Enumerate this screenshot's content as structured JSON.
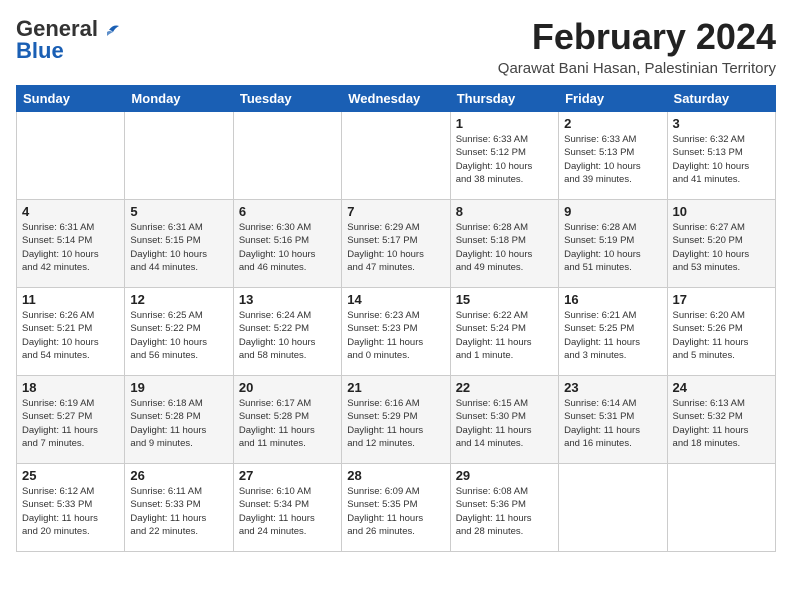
{
  "header": {
    "logo_line1": "General",
    "logo_line2": "Blue",
    "month_year": "February 2024",
    "location": "Qarawat Bani Hasan, Palestinian Territory"
  },
  "columns": [
    "Sunday",
    "Monday",
    "Tuesday",
    "Wednesday",
    "Thursday",
    "Friday",
    "Saturday"
  ],
  "weeks": [
    [
      {
        "day": "",
        "info": ""
      },
      {
        "day": "",
        "info": ""
      },
      {
        "day": "",
        "info": ""
      },
      {
        "day": "",
        "info": ""
      },
      {
        "day": "1",
        "info": "Sunrise: 6:33 AM\nSunset: 5:12 PM\nDaylight: 10 hours\nand 38 minutes."
      },
      {
        "day": "2",
        "info": "Sunrise: 6:33 AM\nSunset: 5:13 PM\nDaylight: 10 hours\nand 39 minutes."
      },
      {
        "day": "3",
        "info": "Sunrise: 6:32 AM\nSunset: 5:13 PM\nDaylight: 10 hours\nand 41 minutes."
      }
    ],
    [
      {
        "day": "4",
        "info": "Sunrise: 6:31 AM\nSunset: 5:14 PM\nDaylight: 10 hours\nand 42 minutes."
      },
      {
        "day": "5",
        "info": "Sunrise: 6:31 AM\nSunset: 5:15 PM\nDaylight: 10 hours\nand 44 minutes."
      },
      {
        "day": "6",
        "info": "Sunrise: 6:30 AM\nSunset: 5:16 PM\nDaylight: 10 hours\nand 46 minutes."
      },
      {
        "day": "7",
        "info": "Sunrise: 6:29 AM\nSunset: 5:17 PM\nDaylight: 10 hours\nand 47 minutes."
      },
      {
        "day": "8",
        "info": "Sunrise: 6:28 AM\nSunset: 5:18 PM\nDaylight: 10 hours\nand 49 minutes."
      },
      {
        "day": "9",
        "info": "Sunrise: 6:28 AM\nSunset: 5:19 PM\nDaylight: 10 hours\nand 51 minutes."
      },
      {
        "day": "10",
        "info": "Sunrise: 6:27 AM\nSunset: 5:20 PM\nDaylight: 10 hours\nand 53 minutes."
      }
    ],
    [
      {
        "day": "11",
        "info": "Sunrise: 6:26 AM\nSunset: 5:21 PM\nDaylight: 10 hours\nand 54 minutes."
      },
      {
        "day": "12",
        "info": "Sunrise: 6:25 AM\nSunset: 5:22 PM\nDaylight: 10 hours\nand 56 minutes."
      },
      {
        "day": "13",
        "info": "Sunrise: 6:24 AM\nSunset: 5:22 PM\nDaylight: 10 hours\nand 58 minutes."
      },
      {
        "day": "14",
        "info": "Sunrise: 6:23 AM\nSunset: 5:23 PM\nDaylight: 11 hours\nand 0 minutes."
      },
      {
        "day": "15",
        "info": "Sunrise: 6:22 AM\nSunset: 5:24 PM\nDaylight: 11 hours\nand 1 minute."
      },
      {
        "day": "16",
        "info": "Sunrise: 6:21 AM\nSunset: 5:25 PM\nDaylight: 11 hours\nand 3 minutes."
      },
      {
        "day": "17",
        "info": "Sunrise: 6:20 AM\nSunset: 5:26 PM\nDaylight: 11 hours\nand 5 minutes."
      }
    ],
    [
      {
        "day": "18",
        "info": "Sunrise: 6:19 AM\nSunset: 5:27 PM\nDaylight: 11 hours\nand 7 minutes."
      },
      {
        "day": "19",
        "info": "Sunrise: 6:18 AM\nSunset: 5:28 PM\nDaylight: 11 hours\nand 9 minutes."
      },
      {
        "day": "20",
        "info": "Sunrise: 6:17 AM\nSunset: 5:28 PM\nDaylight: 11 hours\nand 11 minutes."
      },
      {
        "day": "21",
        "info": "Sunrise: 6:16 AM\nSunset: 5:29 PM\nDaylight: 11 hours\nand 12 minutes."
      },
      {
        "day": "22",
        "info": "Sunrise: 6:15 AM\nSunset: 5:30 PM\nDaylight: 11 hours\nand 14 minutes."
      },
      {
        "day": "23",
        "info": "Sunrise: 6:14 AM\nSunset: 5:31 PM\nDaylight: 11 hours\nand 16 minutes."
      },
      {
        "day": "24",
        "info": "Sunrise: 6:13 AM\nSunset: 5:32 PM\nDaylight: 11 hours\nand 18 minutes."
      }
    ],
    [
      {
        "day": "25",
        "info": "Sunrise: 6:12 AM\nSunset: 5:33 PM\nDaylight: 11 hours\nand 20 minutes."
      },
      {
        "day": "26",
        "info": "Sunrise: 6:11 AM\nSunset: 5:33 PM\nDaylight: 11 hours\nand 22 minutes."
      },
      {
        "day": "27",
        "info": "Sunrise: 6:10 AM\nSunset: 5:34 PM\nDaylight: 11 hours\nand 24 minutes."
      },
      {
        "day": "28",
        "info": "Sunrise: 6:09 AM\nSunset: 5:35 PM\nDaylight: 11 hours\nand 26 minutes."
      },
      {
        "day": "29",
        "info": "Sunrise: 6:08 AM\nSunset: 5:36 PM\nDaylight: 11 hours\nand 28 minutes."
      },
      {
        "day": "",
        "info": ""
      },
      {
        "day": "",
        "info": ""
      }
    ]
  ]
}
